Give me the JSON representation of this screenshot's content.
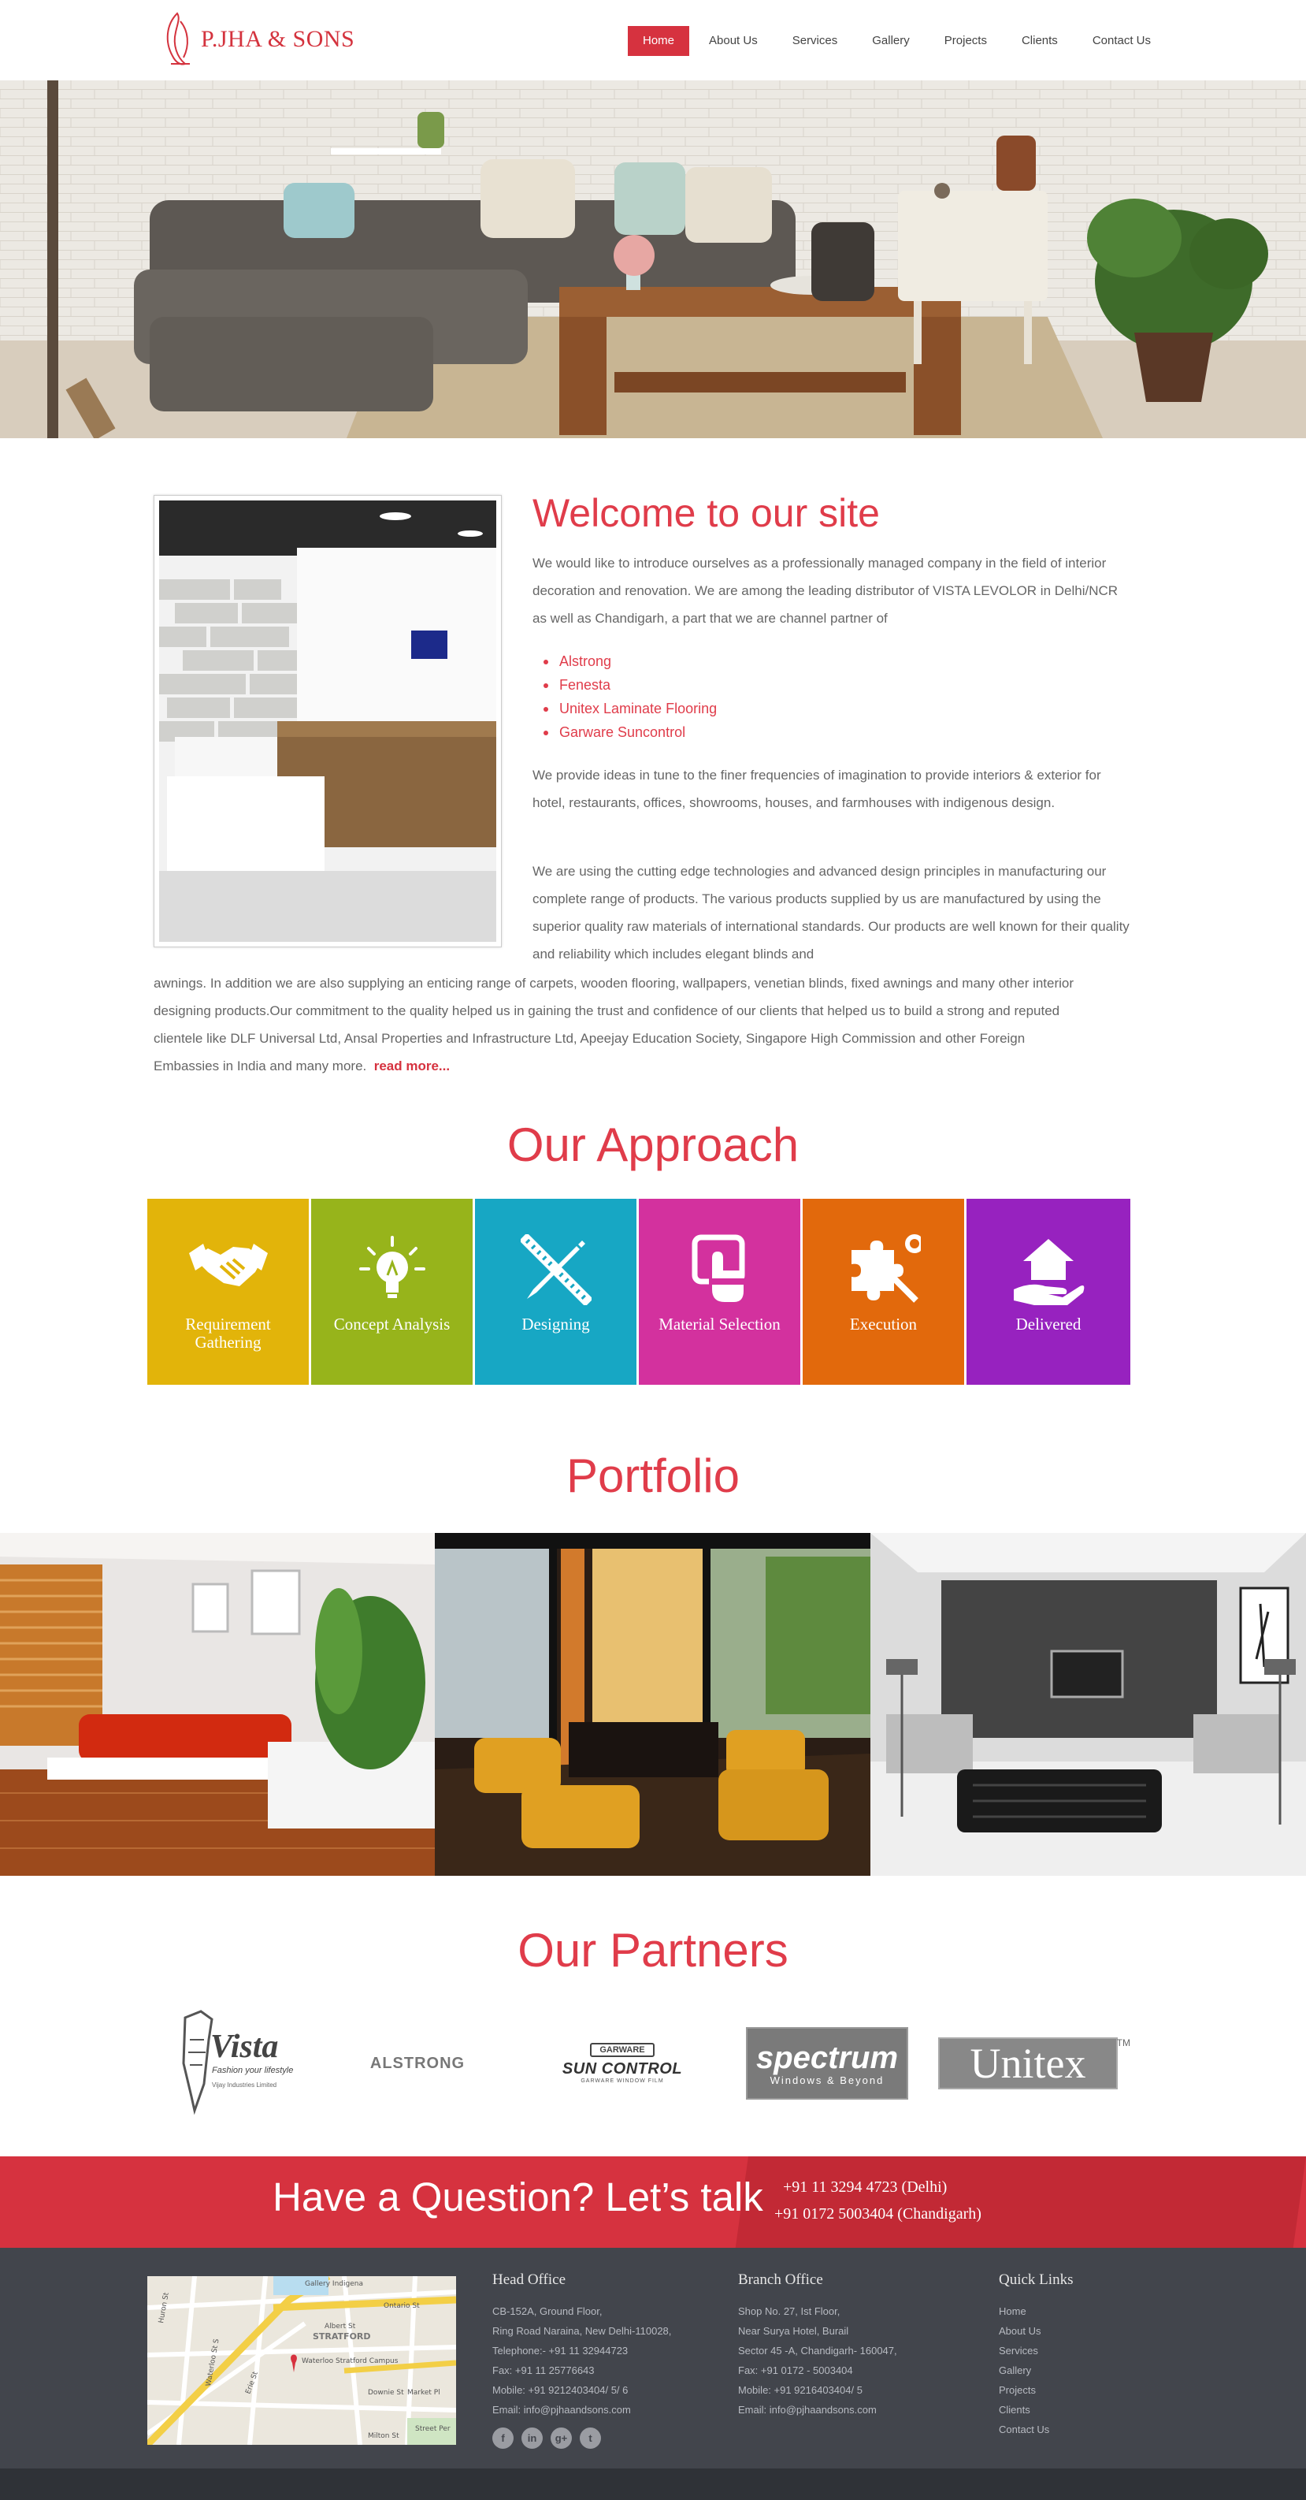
{
  "header": {
    "logo_text": "P.JHA & SONS",
    "nav": [
      {
        "label": "Home",
        "active": true
      },
      {
        "label": "About Us"
      },
      {
        "label": "Services"
      },
      {
        "label": "Gallery"
      },
      {
        "label": "Projects"
      },
      {
        "label": "Clients"
      },
      {
        "label": "Contact Us"
      }
    ]
  },
  "welcome": {
    "title": "Welcome to our site",
    "intro": "We would like to introduce ourselves as a professionally managed company in the field of interior decoration and renovation. We are among the leading distributor of VISTA LEVOLOR in Delhi/NCR as well as Chandigarh, a part that we are channel partner of",
    "products": [
      "Alstrong",
      "Fenesta",
      "Unitex Laminate Flooring",
      "Garware Suncontrol"
    ],
    "para2": "We provide ideas in tune to the finer frequencies of imagination to provide interiors & exterior for hotel, restaurants, offices, showrooms, houses, and farmhouses with indigenous design.",
    "para3_top": "We are using the cutting edge technologies and advanced design principles in manufacturing our complete range of products. The various products supplied by us are manufactured by using the superior quality raw materials of international standards. Our products are well known for their quality and reliability which includes elegant blinds and",
    "para3_bottom": "awnings. In addition we are also supplying an enticing range of carpets, wooden flooring, wallpapers, venetian blinds, fixed awnings and many other interior designing products.Our commitment to the quality helped us in gaining the trust and confidence of our clients that helped us to build a strong and reputed clientele like DLF Universal Ltd, Ansal Properties and Infrastructure Ltd, Apeejay Education Society, Singapore High Commission and other Foreign Embassies in India and many more.",
    "read_more": "read more..."
  },
  "approach": {
    "title": "Our Approach",
    "steps": [
      {
        "label": "Requirement Gathering",
        "color": "#e2b40a",
        "icon": "handshake-icon"
      },
      {
        "label": "Concept Analysis",
        "color": "#97b41b",
        "icon": "lightbulb-icon"
      },
      {
        "label": "Designing",
        "color": "#17a7c4",
        "icon": "pencil-ruler-icon"
      },
      {
        "label": "Material Selection",
        "color": "#d3319e",
        "icon": "touch-select-icon"
      },
      {
        "label": "Execution",
        "color": "#e2690c",
        "icon": "puzzle-icon"
      },
      {
        "label": "Delivered",
        "color": "#9722bf",
        "icon": "house-in-hand-icon"
      }
    ]
  },
  "portfolio": {
    "title": "Portfolio"
  },
  "partners": {
    "title": "Our Partners",
    "logos": [
      {
        "name": "Vista",
        "tagline": "Fashion your lifestyle",
        "sub": "Vijay Industries Limited"
      },
      {
        "name": "ALSTRONG"
      },
      {
        "name": "SUN CONTROL",
        "top": "GARWARE",
        "sub": "GARWARE WINDOW FILM"
      },
      {
        "name": "spectrum",
        "sub": "Windows & Beyond"
      },
      {
        "name": "Unitex",
        "mark": "TM"
      }
    ]
  },
  "talk": {
    "title": "Have a Question? Let’s talk",
    "phone_delhi": "+91 11 3294 4723 (Delhi)",
    "phone_chandigarh": "+91 0172 5003404 (Chandigarh)"
  },
  "footer": {
    "head_office": {
      "title": "Head Office",
      "lines": [
        "CB-152A, Ground Floor,",
        "Ring Road Naraina, New Delhi-110028,",
        "Telephone:- +91 11 32944723",
        "Fax: +91 11 25776643",
        "Mobile: +91 9212403404/ 5/ 6",
        "Email: info@pjhaandsons.com"
      ]
    },
    "branch_office": {
      "title": "Branch Office",
      "lines": [
        "Shop No. 27, Ist Floor,",
        "Near Surya Hotel, Burail",
        "Sector 45 -A, Chandigarh- 160047,",
        "Fax: +91 0172 - 5003404",
        "Mobile: +91 9216403404/ 5",
        "Email: info@pjhaandsons.com"
      ]
    },
    "quick_links": {
      "title": "Quick Links",
      "items": [
        "Home",
        "About Us",
        "Services",
        "Gallery",
        "Projects",
        "Clients",
        "Contact Us"
      ]
    },
    "social": [
      {
        "icon": "facebook-icon",
        "glyph": "f"
      },
      {
        "icon": "linkedin-icon",
        "glyph": "in"
      },
      {
        "icon": "google-plus-icon",
        "glyph": "g+"
      },
      {
        "icon": "twitter-icon",
        "glyph": "t"
      }
    ],
    "map_labels": [
      "Gallery Indigena",
      "Waterloo Stratford Campus",
      "Ontario St",
      "STRATFORD",
      "Erie St",
      "Downie St",
      "Albert St",
      "Huron St",
      "Waterloo St S",
      "Milton St",
      "Market Pl",
      "Street Per"
    ]
  }
}
